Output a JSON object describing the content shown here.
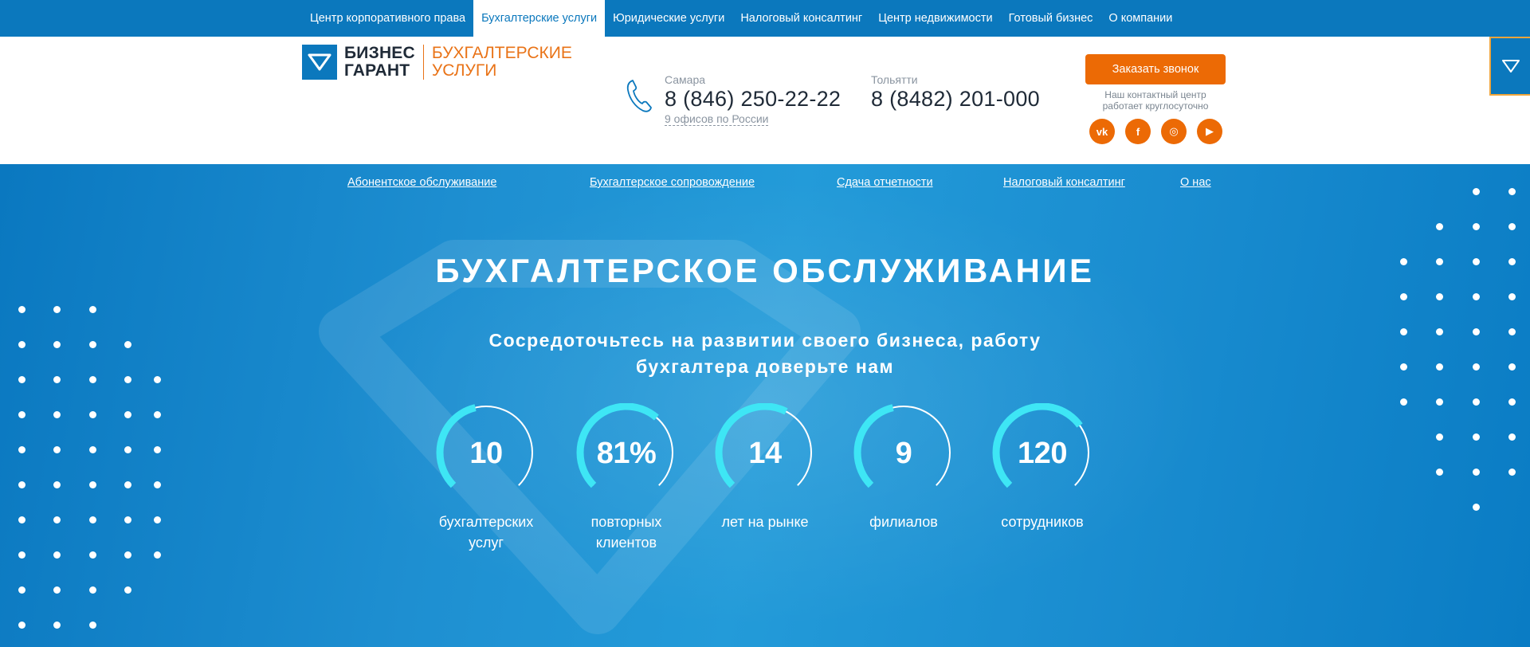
{
  "topnav": {
    "items": [
      {
        "label": "Центр корпоративного права"
      },
      {
        "label": "Бухгалтерские услуги",
        "active": true
      },
      {
        "label": "Юридические услуги"
      },
      {
        "label": "Налоговый консалтинг"
      },
      {
        "label": "Центр недвижимости"
      },
      {
        "label": "Готовый бизнес"
      },
      {
        "label": "О компании"
      }
    ]
  },
  "header": {
    "logo": {
      "brand_line1": "БИЗНЕС",
      "brand_line2": "ГАРАНТ",
      "sub_line1": "БУХГАЛТЕРСКИЕ",
      "sub_line2": "УСЛУГИ"
    },
    "phones": [
      {
        "city": "Самара",
        "number": "8 (846) 250-22-22"
      },
      {
        "city": "Тольятти",
        "number": "8 (8482) 201-000"
      }
    ],
    "offices_link": "9 офисов по России",
    "call_button": "Заказать звонок",
    "contact_note_line1": "Наш контактный центр",
    "contact_note_line2": "работает круглосуточно",
    "socials": [
      {
        "icon": "vk-icon",
        "glyph": "vk"
      },
      {
        "icon": "facebook-icon",
        "glyph": "f"
      },
      {
        "icon": "instagram-icon",
        "glyph": "◎"
      },
      {
        "icon": "youtube-icon",
        "glyph": "▶"
      }
    ]
  },
  "subnav": {
    "items": [
      {
        "label": "Абонентское обслуживание"
      },
      {
        "label": "Бухгалтерское сопровождение"
      },
      {
        "label": "Сдача отчетности"
      },
      {
        "label": "Налоговый консалтинг"
      },
      {
        "label": "О нас"
      }
    ]
  },
  "hero": {
    "title": "БУХГАЛТЕРСКОЕ ОБСЛУЖИВАНИЕ",
    "subtitle_line1": "Сосредоточьтесь на развитии своего бизнеса, работу",
    "subtitle_line2": "бухгалтера доверьте нам"
  },
  "stats": [
    {
      "value": "10",
      "label_line1": "бухгалтерских",
      "label_line2": "услуг",
      "fill": 0.45
    },
    {
      "value": "81%",
      "label_line1": "повторных",
      "label_line2": "клиентов",
      "fill": 0.65
    },
    {
      "value": "14",
      "label_line1": "лет на рынке",
      "label_line2": "",
      "fill": 0.6
    },
    {
      "value": "9",
      "label_line1": "филиалов",
      "label_line2": "",
      "fill": 0.45
    },
    {
      "value": "120",
      "label_line1": "сотрудников",
      "label_line2": "",
      "fill": 0.7
    }
  ],
  "colors": {
    "brand_blue": "#0b78bd",
    "accent_orange": "#ec6a05",
    "arc_cyan": "#3ee6f5"
  }
}
